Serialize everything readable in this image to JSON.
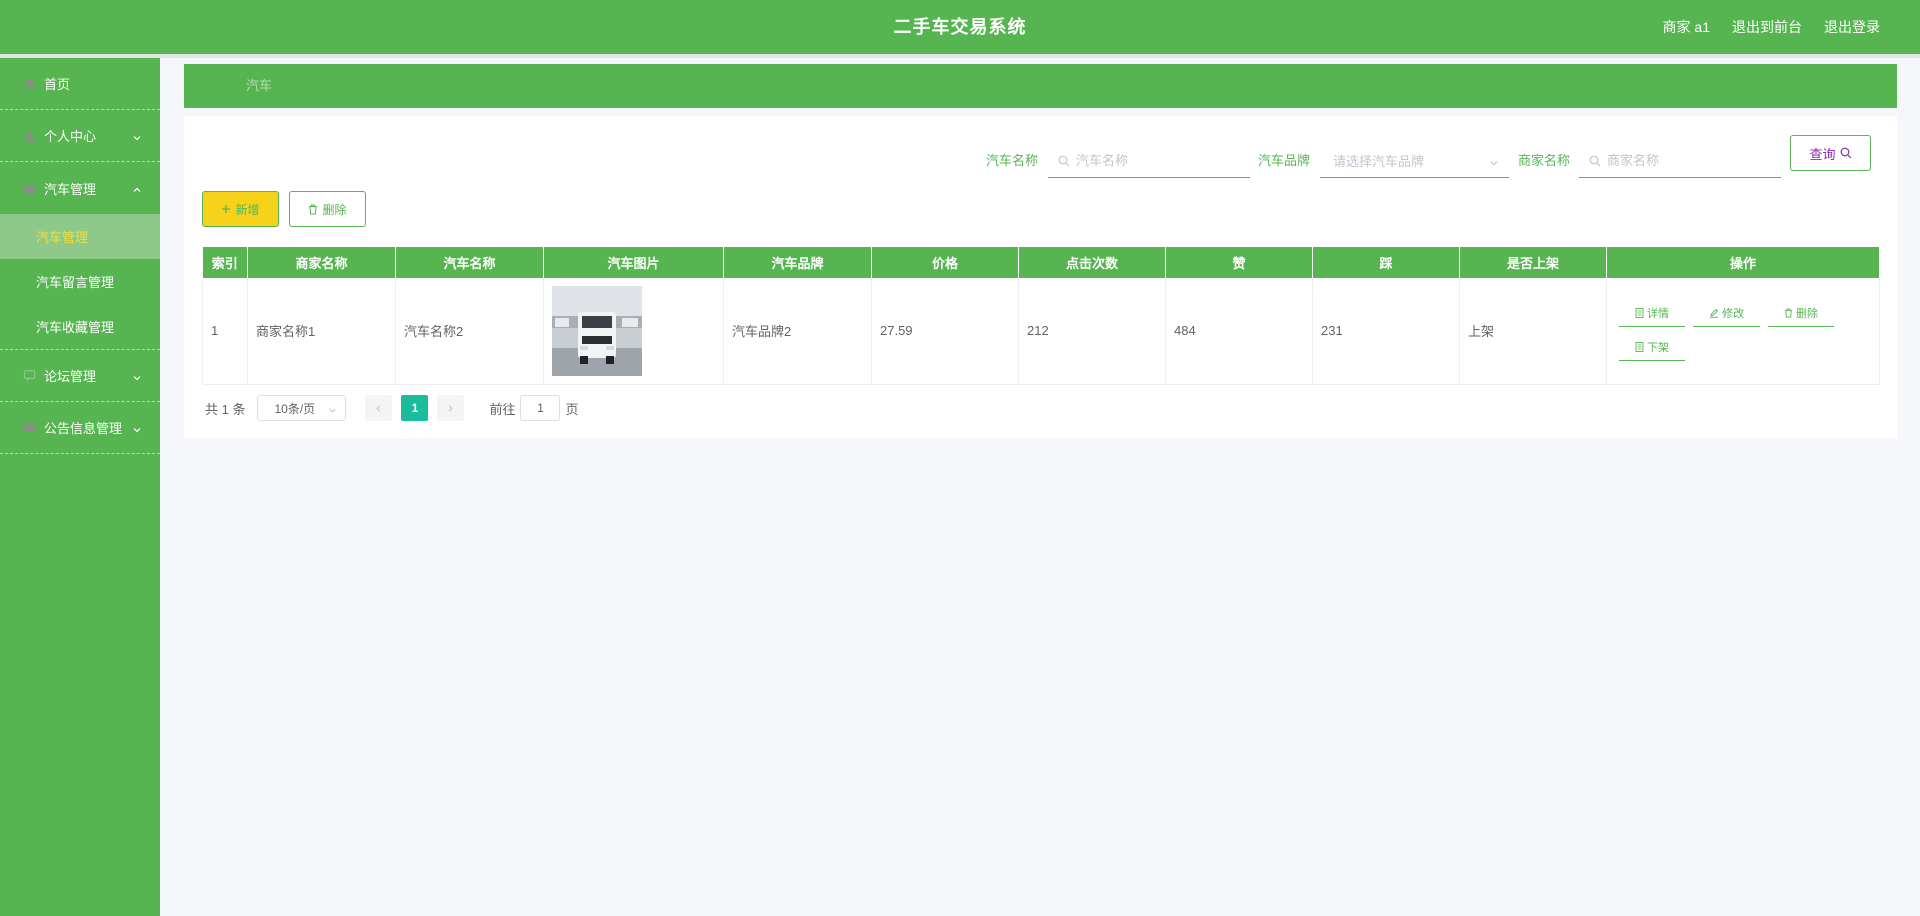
{
  "header": {
    "title": "二手车交易系统",
    "user_label": "商家 a1",
    "front_link": "退出到前台",
    "logout_link": "退出登录"
  },
  "sidebar": {
    "items": [
      {
        "label": "首页",
        "icon": "home-icon"
      },
      {
        "label": "个人中心",
        "icon": "user-icon"
      },
      {
        "label": "汽车管理",
        "icon": "car-icon",
        "expanded": true,
        "children": [
          "汽车管理",
          "汽车留言管理",
          "汽车收藏管理"
        ],
        "active_child": 0
      },
      {
        "label": "论坛管理",
        "icon": "forum-icon"
      },
      {
        "label": "公告信息管理",
        "icon": "notice-icon"
      }
    ]
  },
  "breadcrumb": {
    "current": "汽车"
  },
  "search": {
    "car_name_label": "汽车名称",
    "car_name_placeholder": "汽车名称",
    "brand_label": "汽车品牌",
    "brand_placeholder": "请选择汽车品牌",
    "merchant_label": "商家名称",
    "merchant_placeholder": "商家名称",
    "query_button": "查询"
  },
  "actions": {
    "add_button": "新增",
    "delete_button": "删除"
  },
  "table": {
    "columns": [
      "索引",
      "商家名称",
      "汽车名称",
      "汽车图片",
      "汽车品牌",
      "价格",
      "点击次数",
      "赞",
      "踩",
      "是否上架",
      "操作"
    ],
    "rows": [
      {
        "index": "1",
        "merchant": "商家名称1",
        "car_name": "汽车名称2",
        "brand": "汽车品牌2",
        "price": "27.59",
        "clicks": "212",
        "likes": "484",
        "dislikes": "231",
        "on_shelf": "上架",
        "ops": [
          "详情",
          "修改",
          "删除",
          "下架"
        ]
      }
    ]
  },
  "pagination": {
    "total_text": "共 1 条",
    "page_size": "10条/页",
    "current_page": "1",
    "goto_label": "前往",
    "goto_value": "1",
    "page_unit": "页"
  },
  "colors": {
    "primary": "#57b551",
    "active_text": "#f4df3a",
    "add_button_bg": "#f6d21b",
    "page_active": "#1abc9c"
  }
}
